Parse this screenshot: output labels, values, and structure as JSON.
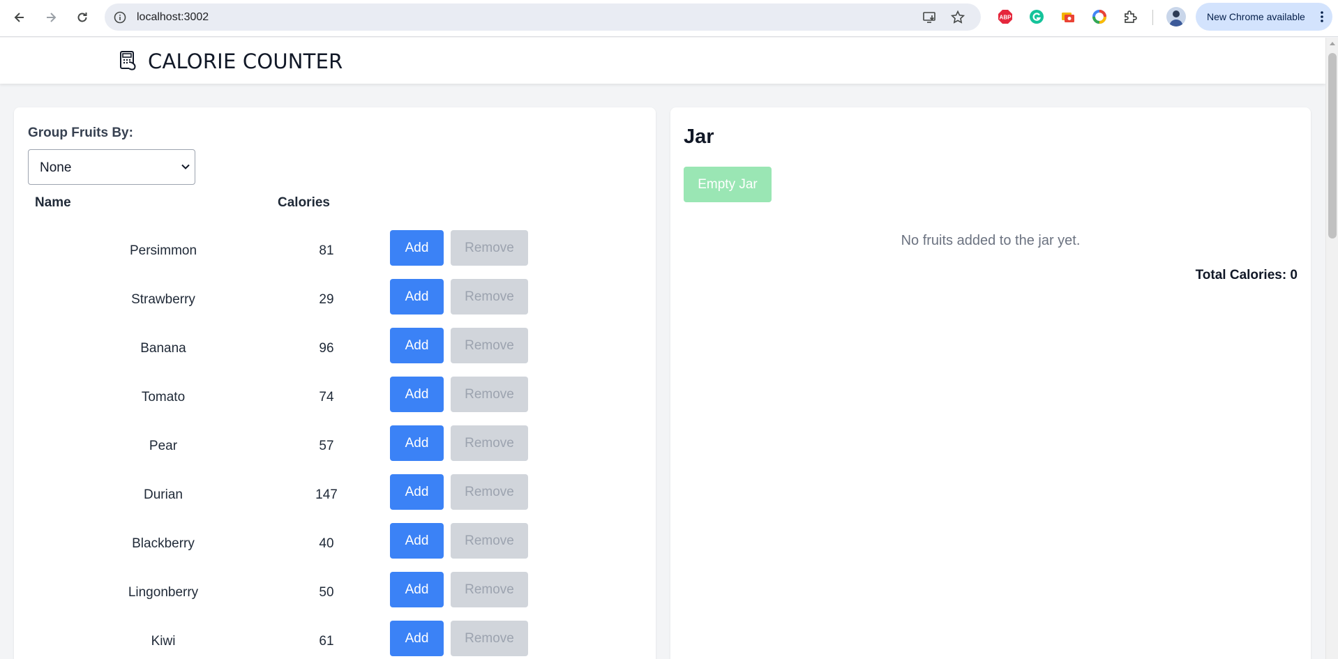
{
  "browser": {
    "url": "localhost:3002",
    "update_label": "New Chrome available"
  },
  "header": {
    "title": "CALORIE COUNTER"
  },
  "fruit_panel": {
    "group_label": "Group Fruits By:",
    "group_value": "None",
    "col_name": "Name",
    "col_calories": "Calories",
    "add_label": "Add",
    "remove_label": "Remove",
    "fruits": [
      {
        "name": "Persimmon",
        "calories": "81"
      },
      {
        "name": "Strawberry",
        "calories": "29"
      },
      {
        "name": "Banana",
        "calories": "96"
      },
      {
        "name": "Tomato",
        "calories": "74"
      },
      {
        "name": "Pear",
        "calories": "57"
      },
      {
        "name": "Durian",
        "calories": "147"
      },
      {
        "name": "Blackberry",
        "calories": "40"
      },
      {
        "name": "Lingonberry",
        "calories": "50"
      },
      {
        "name": "Kiwi",
        "calories": "61"
      }
    ]
  },
  "jar_panel": {
    "title": "Jar",
    "empty_button": "Empty Jar",
    "empty_message": "No fruits added to the jar yet.",
    "total_label": "Total Calories: 0"
  },
  "colors": {
    "add_button": "#3b82f6",
    "remove_button": "#d1d5db",
    "empty_button": "#9ae6b4"
  }
}
